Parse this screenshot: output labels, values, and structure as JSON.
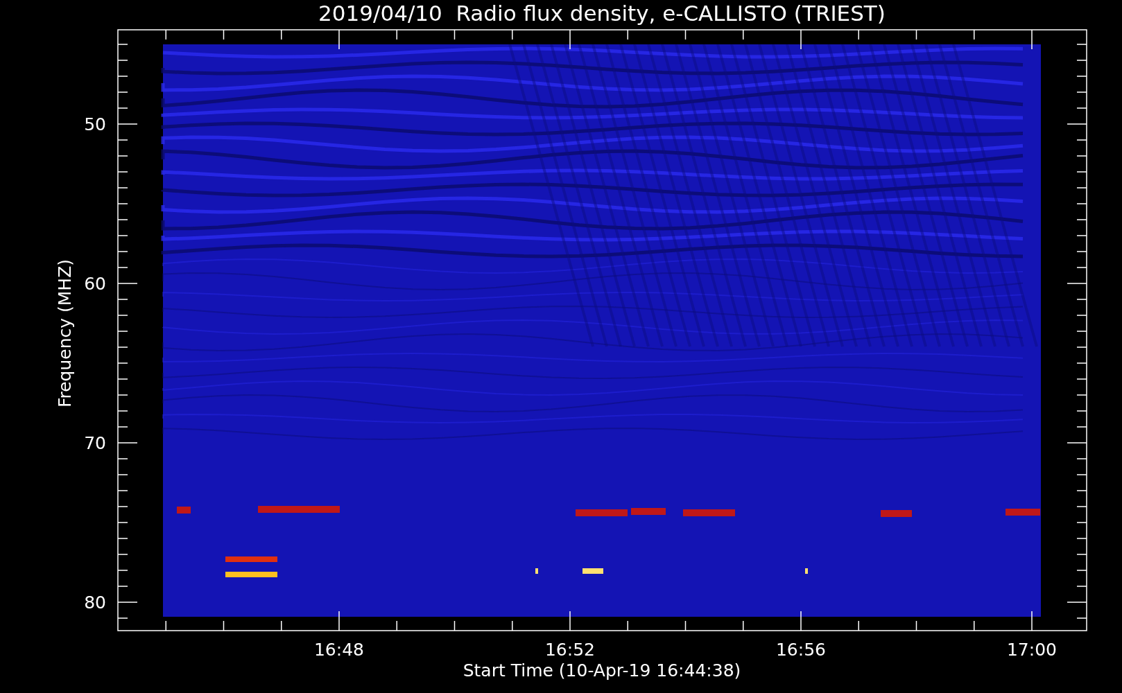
{
  "plot": {
    "title": "2019/04/10  Radio flux density, e-CALLISTO (TRIEST)",
    "ylabel": "Frequency (MHZ)",
    "xlabel": "Start Time (10-Apr-19 16:44:38)",
    "y_ticks": [
      "50",
      "60",
      "70",
      "80"
    ],
    "x_ticks": [
      "16:48",
      "16:52",
      "16:56",
      "17:00"
    ]
  }
}
